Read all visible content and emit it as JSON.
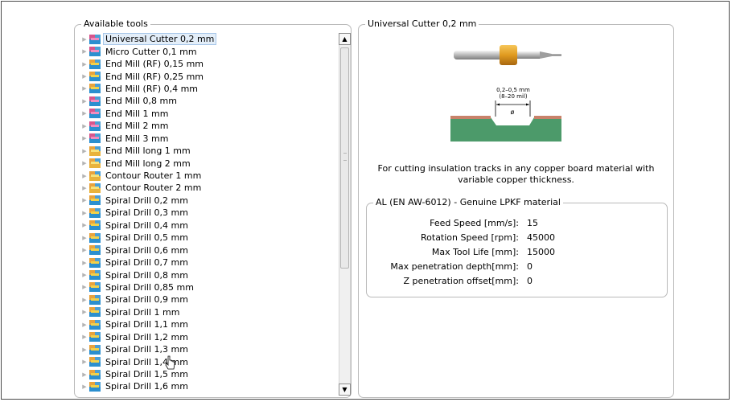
{
  "tools": {
    "legend": "Available tools",
    "items": [
      {
        "label": "Universal Cutter 0,2 mm",
        "color": "pink",
        "selected": true
      },
      {
        "label": "Micro Cutter 0,1 mm",
        "color": "pink"
      },
      {
        "label": "End Mill (RF) 0,15 mm",
        "color": "blue"
      },
      {
        "label": "End Mill (RF) 0,25 mm",
        "color": "blue"
      },
      {
        "label": "End Mill (RF) 0,4 mm",
        "color": "blue"
      },
      {
        "label": "End Mill 0,8 mm",
        "color": "pink"
      },
      {
        "label": "End Mill 1 mm",
        "color": "pink"
      },
      {
        "label": "End Mill 2 mm",
        "color": "pink"
      },
      {
        "label": "End Mill 3 mm",
        "color": "pink"
      },
      {
        "label": "End Mill long 1 mm",
        "color": "yellow"
      },
      {
        "label": "End Mill long 2 mm",
        "color": "yellow"
      },
      {
        "label": "Contour Router 1 mm",
        "color": "yellow"
      },
      {
        "label": "Contour Router 2 mm",
        "color": "yellow"
      },
      {
        "label": "Spiral Drill  0,2 mm",
        "color": "blue"
      },
      {
        "label": "Spiral Drill  0,3 mm",
        "color": "blue"
      },
      {
        "label": "Spiral Drill  0,4 mm",
        "color": "blue"
      },
      {
        "label": "Spiral Drill  0,5 mm",
        "color": "blue"
      },
      {
        "label": "Spiral Drill  0,6 mm",
        "color": "blue"
      },
      {
        "label": "Spiral Drill  0,7 mm",
        "color": "blue"
      },
      {
        "label": "Spiral Drill  0,8 mm",
        "color": "blue"
      },
      {
        "label": "Spiral Drill  0,85 mm",
        "color": "blue"
      },
      {
        "label": "Spiral Drill  0,9 mm",
        "color": "blue"
      },
      {
        "label": "Spiral Drill  1 mm",
        "color": "blue"
      },
      {
        "label": "Spiral Drill  1,1 mm",
        "color": "blue"
      },
      {
        "label": "Spiral Drill  1,2 mm",
        "color": "blue"
      },
      {
        "label": "Spiral Drill  1,3 mm",
        "color": "blue"
      },
      {
        "label": "Spiral Drill  1,4 mm",
        "color": "blue"
      },
      {
        "label": "Spiral Drill  1,5 mm",
        "color": "blue"
      },
      {
        "label": "Spiral Drill  1,6 mm",
        "color": "blue"
      }
    ]
  },
  "detail": {
    "legend": "Universal Cutter 0,2 mm",
    "diagram": {
      "range_mm": "0,2–0,5 mm",
      "range_mil": "(8–20 mil)",
      "diameter_symbol": "ø"
    },
    "description_line1": "For cutting insulation tracks in any copper board material with",
    "description_line2": "variable copper thickness.",
    "material": {
      "legend": "AL (EN AW-6012) - Genuine LPKF material",
      "props": [
        {
          "label": "Feed Speed [mm/s]:",
          "value": "15"
        },
        {
          "label": "Rotation Speed [rpm]:",
          "value": "45000"
        },
        {
          "label": "Max Tool Life [mm]:",
          "value": "15000"
        },
        {
          "label": "Max penetration depth[mm]:",
          "value": "0"
        },
        {
          "label": "Z penetration offset[mm]:",
          "value": "0"
        }
      ]
    }
  },
  "colors": {
    "pcb_green": "#4c9a6a",
    "copper": "#c8826a",
    "tool_gold": "#e9a531"
  }
}
